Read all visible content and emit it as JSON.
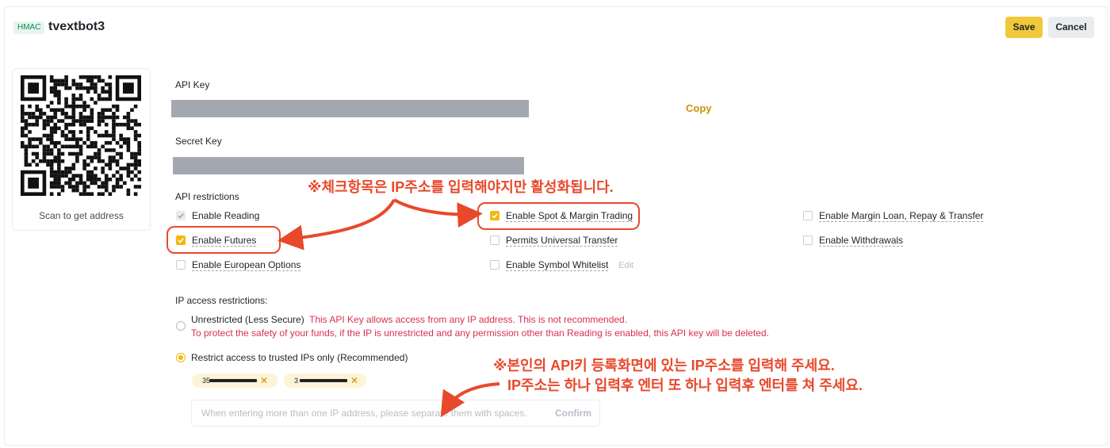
{
  "header": {
    "badge": "HMAC",
    "title": "tvextbot3",
    "save_label": "Save",
    "cancel_label": "Cancel"
  },
  "qr": {
    "caption": "Scan to get address"
  },
  "api_key": {
    "label": "API Key",
    "copy_label": "Copy"
  },
  "secret_key": {
    "label": "Secret Key"
  },
  "restrictions": {
    "label": "API restrictions",
    "items": [
      {
        "label": "Enable Reading",
        "state": "checked-disabled"
      },
      {
        "label": "Enable Spot & Margin Trading",
        "state": "checked"
      },
      {
        "label": "Enable Margin Loan, Repay & Transfer",
        "state": "unchecked"
      },
      {
        "label": "Enable Futures",
        "state": "checked"
      },
      {
        "label": "Permits Universal Transfer",
        "state": "unchecked"
      },
      {
        "label": "Enable Withdrawals",
        "state": "unchecked"
      },
      {
        "label": "Enable European Options",
        "state": "unchecked"
      },
      {
        "label": "Enable Symbol Whitelist",
        "state": "unchecked"
      }
    ],
    "edit_label": "Edit"
  },
  "ip_access": {
    "label": "IP access restrictions:",
    "unrestricted_label": "Unrestricted (Less Secure)",
    "unrestricted_warning_1": "This API Key allows access from any IP address. This is not recommended.",
    "unrestricted_warning_2": "To protect the safety of your funds, if the IP is unrestricted and any permission other than Reading is enabled, this API key will be deleted.",
    "restricted_label": "Restrict access to trusted IPs only (Recommended)",
    "selected": "restricted",
    "ip_chips": [
      "35",
      "3"
    ],
    "input_placeholder": "When entering more than one IP address, please separate them with spaces.",
    "confirm_label": "Confirm"
  },
  "annotations": {
    "note_1": "※체크항목은 IP주소를 입력해야지만 활성화됩니다.",
    "note_2_line1": "※본인의 API키 등록화면에 있는 IP주소를 입력해 주세요.",
    "note_2_line2": "IP주소는 하나 입력후 엔터 또 하나 입력후 엔터를 쳐 주세요.",
    "color": "#e8492b"
  },
  "colors": {
    "accent": "#f0b90b",
    "warning": "#d9304e",
    "masked_bar": "#a3a8b0"
  }
}
